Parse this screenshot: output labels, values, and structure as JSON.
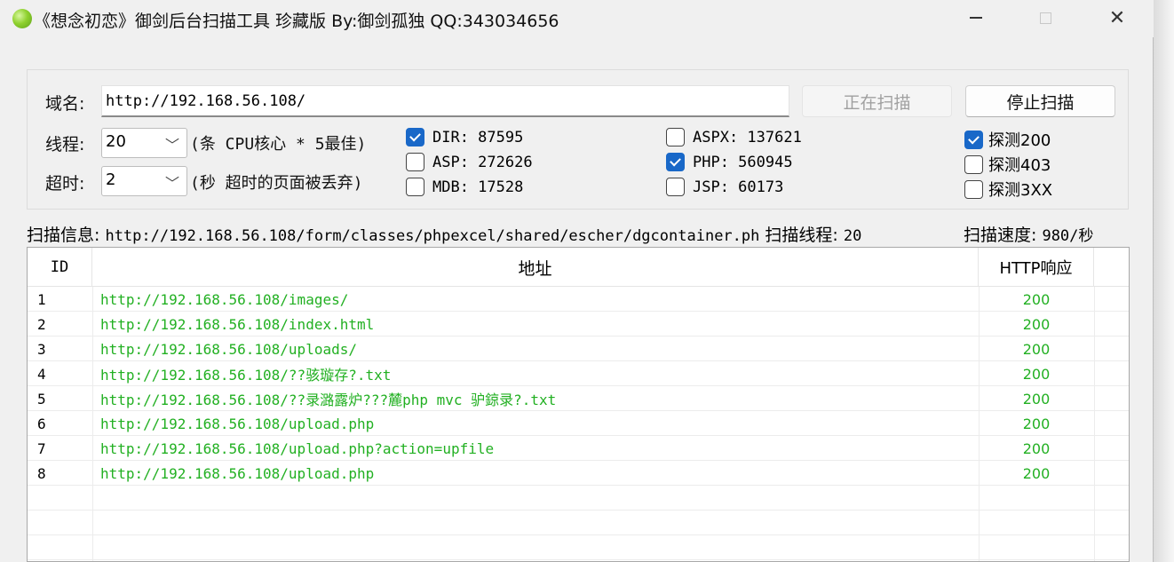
{
  "window": {
    "title": "《想念初恋》御剑后台扫描工具 珍藏版 By:御剑孤独 QQ:343034656",
    "controls": {
      "close": "✕"
    }
  },
  "form": {
    "domain_label": "域名:",
    "domain_value": "http://192.168.56.108/",
    "scanning_button": "正在扫描",
    "stop_button": "停止扫描",
    "threads_label": "线程:",
    "threads_value": "20",
    "threads_hint": "(条 CPU核心 * 5最佳)",
    "timeout_label": "超时:",
    "timeout_value": "2",
    "timeout_hint": "(秒 超时的页面被丢弃)"
  },
  "dictionaries": [
    {
      "label": "DIR: 87595",
      "checked": true
    },
    {
      "label": "ASP: 272626",
      "checked": false
    },
    {
      "label": "MDB: 17528",
      "checked": false
    },
    {
      "label": "ASPX: 137621",
      "checked": false
    },
    {
      "label": "PHP: 560945",
      "checked": true
    },
    {
      "label": "JSP: 60173",
      "checked": false
    }
  ],
  "detect": [
    {
      "label": "探测200",
      "checked": true
    },
    {
      "label": "探测403",
      "checked": false
    },
    {
      "label": "探测3XX",
      "checked": false
    }
  ],
  "status": {
    "info_label": "扫描信息:",
    "info_value": "http://192.168.56.108/form/classes/phpexcel/shared/escher/dgcontainer.ph",
    "threads_label": "扫描线程:",
    "threads_value": "20",
    "speed_label": "扫描速度:",
    "speed_value": "980/秒"
  },
  "table": {
    "columns": [
      "ID",
      "地址",
      "HTTP响应"
    ],
    "rows": [
      {
        "id": "1",
        "url": "http://192.168.56.108/images/",
        "code": "200"
      },
      {
        "id": "2",
        "url": "http://192.168.56.108/index.html",
        "code": "200"
      },
      {
        "id": "3",
        "url": "http://192.168.56.108/uploads/",
        "code": "200"
      },
      {
        "id": "4",
        "url": "http://192.168.56.108/??骇璇存?.txt",
        "code": "200"
      },
      {
        "id": "5",
        "url": "http://192.168.56.108/??录潞露炉???麓php mvc 驴鍄录?.txt",
        "code": "200"
      },
      {
        "id": "6",
        "url": "http://192.168.56.108/upload.php",
        "code": "200"
      },
      {
        "id": "7",
        "url": "http://192.168.56.108/upload.php?action=upfile",
        "code": "200"
      },
      {
        "id": "8",
        "url": "http://192.168.56.108/upload.php",
        "code": "200"
      }
    ]
  },
  "colors": {
    "accent": "#1968c8",
    "ok_text": "#22b022"
  }
}
